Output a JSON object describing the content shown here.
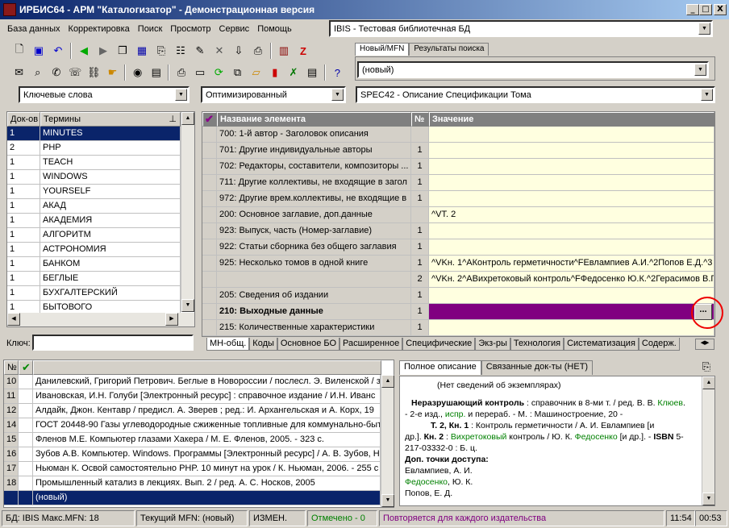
{
  "window": {
    "title": "ИРБИС64 - АРМ \"Каталогизатор\" - Демонстрационная версия",
    "min": "_",
    "max": "□",
    "close": "X"
  },
  "menu": [
    "База данных",
    "Корректировка",
    "Поиск",
    "Просмотр",
    "Сервис",
    "Помощь"
  ],
  "db_combo": "IBIS - Тестовая библиотечная БД",
  "right_tabs": [
    "Новый/MFN",
    "Результаты поиска"
  ],
  "new_combo": "(новый)",
  "search_combos": [
    "Ключевые слова",
    "Оптимизированный",
    "SPEC42 - Описание Спецификации Тома"
  ],
  "terms": {
    "headers": [
      "Док-ов",
      "Термины"
    ],
    "rows": [
      [
        "1",
        "MINUTES"
      ],
      [
        "2",
        "PHP"
      ],
      [
        "1",
        "TEACH"
      ],
      [
        "1",
        "WINDOWS"
      ],
      [
        "1",
        "YOURSELF"
      ],
      [
        "1",
        "АКАД"
      ],
      [
        "1",
        "АКАДЕМИЯ"
      ],
      [
        "1",
        "АЛГОРИТМ"
      ],
      [
        "1",
        "АСТРОНОМИЯ"
      ],
      [
        "1",
        "БАНКОМ"
      ],
      [
        "1",
        "БЕГЛЫЕ"
      ],
      [
        "1",
        "БУХГАЛТЕРСКИЙ"
      ],
      [
        "1",
        "БЫТОВОГО"
      ]
    ],
    "key_label": "Ключ:"
  },
  "fields": {
    "headers": [
      "Название элемента",
      "№",
      "Значение"
    ],
    "rows": [
      {
        "name": "700: 1-й автор - Заголовок описания",
        "n": "",
        "v": ""
      },
      {
        "name": "701: Другие индивидуальные авторы",
        "n": "1",
        "v": ""
      },
      {
        "name": "702: Редакторы, составители, композиторы ...",
        "n": "1",
        "v": ""
      },
      {
        "name": "711: Другие коллективы, не входящие в загол",
        "n": "1",
        "v": ""
      },
      {
        "name": "972: Другие врем.коллективы, не входящие в",
        "n": "1",
        "v": ""
      },
      {
        "name": "200: Основное заглавие, доп.данные",
        "n": "",
        "v": "^VT. 2"
      },
      {
        "name": "923: Выпуск, часть (Номер-заглавие)",
        "n": "1",
        "v": ""
      },
      {
        "name": "922: Статьи сборника без общего заглавия",
        "n": "1",
        "v": ""
      },
      {
        "name": "925: Несколько томов в одной книге",
        "n": "1",
        "v": "^VKн. 1^AКонтроль герметичности^FЕвлампиев А.И.^2Попов Е.Д.^3"
      },
      {
        "name": "",
        "n": "2",
        "v": "^VKн. 2^AВихретоковый контроль^FФедосенко Ю.К.^2Герасимов В.Г"
      },
      {
        "name": "205: Сведения об издании",
        "n": "1",
        "v": ""
      },
      {
        "name": "210: Выходные данные",
        "n": "1",
        "v": ""
      },
      {
        "name": "215: Количественные характеристики",
        "n": "1",
        "v": ""
      }
    ],
    "ellipsis": "..."
  },
  "worksheet_tabs": [
    "МН-общ.",
    "Коды",
    "Основное БО",
    "Расширенное",
    "Специфические",
    "Экз-ры",
    "Технология",
    "Систематизация",
    "Содерж."
  ],
  "records": {
    "header": "№",
    "rows": [
      [
        "10",
        "Данилевский, Григорий Петрович. Беглые в Новороссии / послесл. Э. Виленской / з"
      ],
      [
        "11",
        "Ивановская, И.Н. Голуби [Электронный ресурс] : справочное издание / И.Н. Иванс"
      ],
      [
        "12",
        "Алдайк, Джон. Кентавр / предисл. А. Зверев ; ред.: И. Архангельская и А. Корх, 19"
      ],
      [
        "14",
        "ГОСТ 20448-90 Газы углеводородные сжиженные топливные для коммунально-быт"
      ],
      [
        "15",
        "Фленов М.Е. Компьютер глазами Хакера / М. Е. Фленов, 2005. - 323 с."
      ],
      [
        "16",
        "Зубов А.В. Компьютер. Windows. Программы [Электронный ресурс] / А. В. Зубов, Н"
      ],
      [
        "17",
        "Ньюман К. Освой самостоятельно PHP. 10 минут на урок / К. Ньюман, 2006. - 255 с"
      ],
      [
        "18",
        "Промышленный катализ в лекциях. Вып. 2 / ред. А. С. Носков, 2005"
      ],
      [
        "",
        "(новый)"
      ]
    ]
  },
  "desc_tabs": [
    "Полное описание",
    "Связанные док-ты (НЕТ)"
  ],
  "description": {
    "l1": "(Нет сведений об экземплярах)",
    "l2a": "Неразрушающий контроль",
    "l2b": " : справочник в 8-ми т. / ред. В. В. ",
    "l2c": "Клюев",
    "l3a": "- 2-е изд., ",
    "l3b": "испр.",
    "l3c": " и перераб. - М. : Машиностроение, 20 -",
    "l4a": "Т. 2, Кн. 1",
    "l4b": " : Контроль герметичности / А. И. Евлампиев [и",
    "l5a": "др.]. ",
    "l5b": "Кн. 2",
    "l5c": " : ",
    "l5d": "Вихретоковый",
    "l5e": " контроль / Ю. К. ",
    "l5f": "Федосенко",
    "l5g": " [и др.]. - ",
    "l5h": "ISBN",
    "l5i": " 5-",
    "l6": "217-03332-0 : Б. ц.",
    "l7": "Доп. точки доступа:",
    "l8": "Евлампиев, А. И.",
    "l9a": "Федосенко",
    "l9b": ", Ю. К.",
    "l10": "Попов, Е. Д."
  },
  "status": {
    "db": "БД: IBIS Макс.MFN: 18",
    "mfn": "Текущий MFN: (новый)",
    "changed": "ИЗМЕН.",
    "marked": "Отмечено - 0",
    "hint": "Повторяется для каждого издательства",
    "t1": "11:54",
    "t2": "00:53"
  }
}
